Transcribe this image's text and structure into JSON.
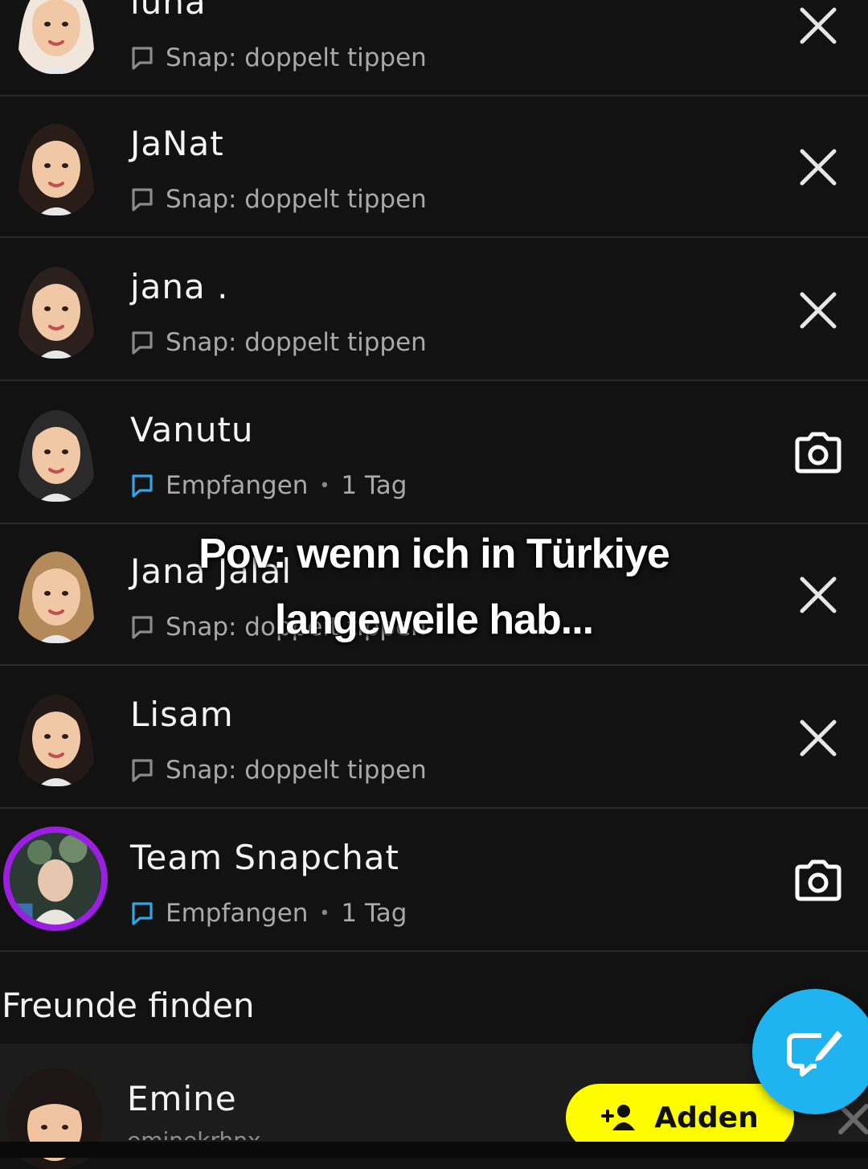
{
  "chats": [
    {
      "name": "luna",
      "status": "Snap: doppelt tippen",
      "time": "",
      "action": "close-icon",
      "hair_color": "#f1e6dc",
      "accent": "#8a8a8a"
    },
    {
      "name": "JaNat",
      "status": "Snap: doppelt tippen",
      "time": "",
      "action": "close-icon",
      "hair_color": "#2a1d18",
      "accent": "#8a8a8a"
    },
    {
      "name": "jana .",
      "status": "Snap: doppelt tippen",
      "time": "",
      "action": "close-icon",
      "hair_color": "#2b201c",
      "accent": "#8a8a8a"
    },
    {
      "name": "Vanutu",
      "status": "Empfangen",
      "time": "1 Tag",
      "action": "camera-icon",
      "hair_color": "#2a2a2a",
      "accent": "#2fa6e8"
    },
    {
      "name": "Jana Jalal",
      "status": "Snap: doppelt tippen",
      "time": "",
      "action": "close-icon",
      "hair_color": "#b58a5a",
      "accent": "#8a8a8a"
    },
    {
      "name": "Lisam",
      "status": "Snap: doppelt tippen",
      "time": "",
      "action": "close-icon",
      "hair_color": "#231917",
      "accent": "#8a8a8a"
    },
    {
      "name": "Team Snapchat",
      "status": "Empfangen",
      "time": "1 Tag",
      "action": "camera-icon",
      "hair_color": "#6e7d72",
      "accent": "#2fa6e8",
      "story_ring": "#9b1fe0"
    }
  ],
  "caption": {
    "line1": "Pov: wenn ich in Türkiye",
    "line2": "langeweile hab..."
  },
  "find_friends": {
    "title": "Freunde finden",
    "suggestion": {
      "name": "Emine",
      "username": "eminekrhnx",
      "add_label": "Adden"
    }
  },
  "colors": {
    "background": "#121212",
    "add_button": "#fffc00",
    "fab": "#1fb4f0",
    "chat_received": "#2fa6e8"
  }
}
